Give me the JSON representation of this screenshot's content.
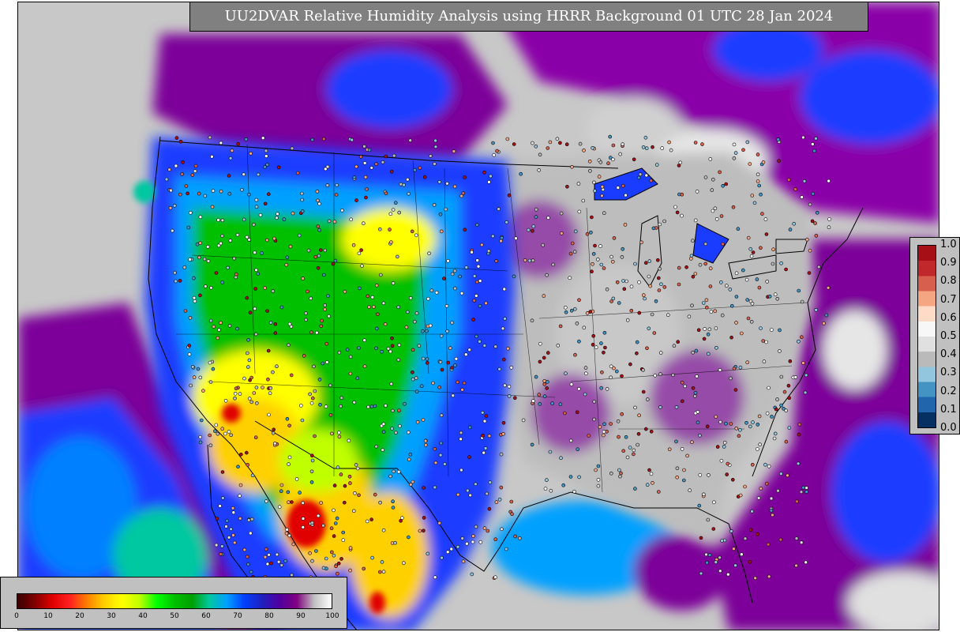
{
  "title": "UU2DVAR Relative Humidity Analysis using HRRR Background 01 UTC 28 Jan 2024",
  "relative_colorbar": {
    "ticks": [
      "1.0",
      "0.9",
      "0.8",
      "0.7",
      "0.6",
      "0.5",
      "0.4",
      "0.3",
      "0.2",
      "0.1",
      "0.0"
    ],
    "colors": [
      "#a50f15",
      "#c0282b",
      "#d6604d",
      "#f4a582",
      "#fddbc7",
      "#f7f7f7",
      "#e0e0e0",
      "#bababa",
      "#92c5de",
      "#4393c3",
      "#2166ac",
      "#053061"
    ]
  },
  "rh_colorbar": {
    "ticks": [
      "0",
      "10",
      "20",
      "30",
      "40",
      "50",
      "60",
      "70",
      "80",
      "90",
      "100"
    ],
    "colors": [
      "#3a0000",
      "#800000",
      "#e00000",
      "#ff2020",
      "#ff8000",
      "#ffd000",
      "#ffff00",
      "#c0ff00",
      "#00ff00",
      "#00c000",
      "#00a000",
      "#00c8a0",
      "#00a0ff",
      "#0040ff",
      "#2020c0",
      "#5000a0",
      "#800080",
      "#c0c0c0",
      "#ffffff"
    ]
  },
  "map_colors": {
    "background_gray": "#c8c8c8",
    "high_rh_purple": "#7b0099",
    "mid_rh_blue": "#1a3cff",
    "low_rh_green": "#00c000",
    "very_low_rh_yellow": "#ffd000",
    "dry_red": "#e00000"
  }
}
